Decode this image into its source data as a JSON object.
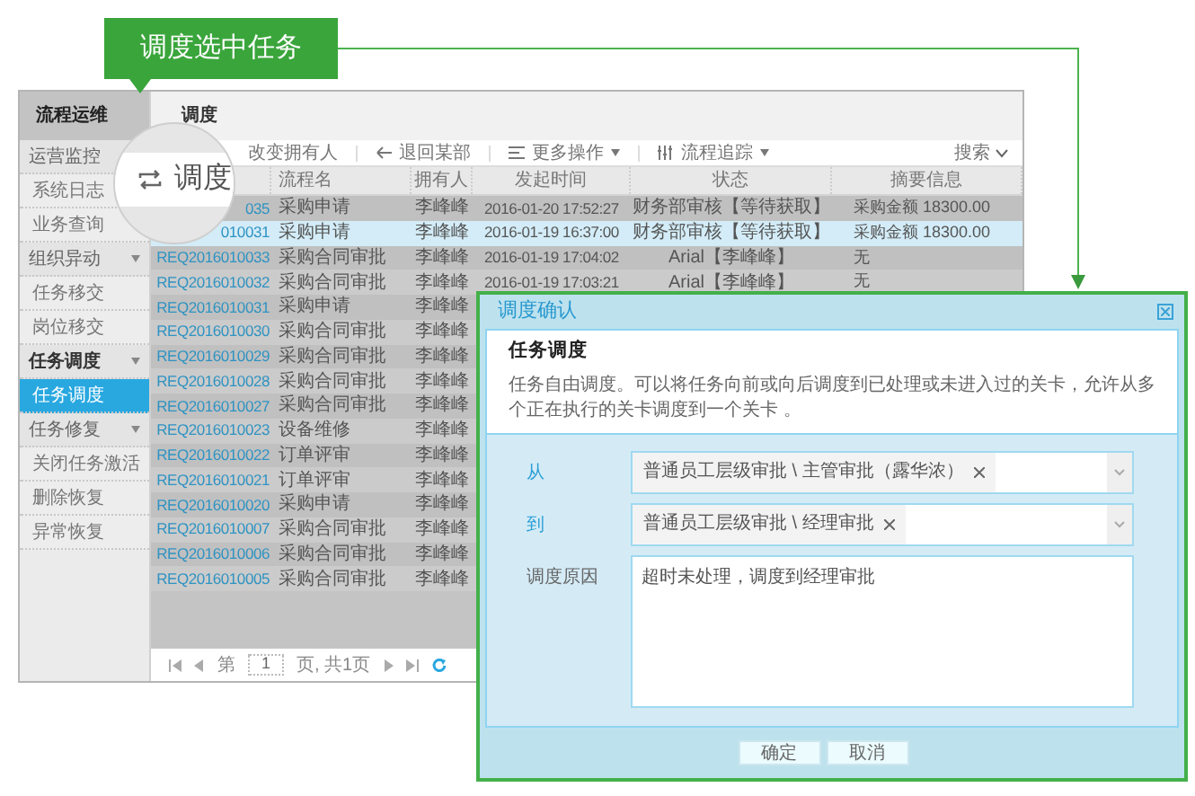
{
  "callout": {
    "text": "调度选中任务"
  },
  "sidebar": {
    "title": "流程运维",
    "groups": [
      {
        "label": "运营监控",
        "collapsible": false,
        "children": [
          {
            "label": "系统日志",
            "selected": false
          },
          {
            "label": "业务查询",
            "selected": false
          }
        ]
      },
      {
        "label": "组织异动",
        "collapsible": true,
        "children": [
          {
            "label": "任务移交",
            "selected": false
          },
          {
            "label": "岗位移交",
            "selected": false
          }
        ]
      },
      {
        "label": "任务调度",
        "collapsible": true,
        "children": [
          {
            "label": "任务调度",
            "selected": true
          }
        ]
      },
      {
        "label": "任务修复",
        "collapsible": true,
        "children": [
          {
            "label": "关闭任务激活",
            "selected": false
          },
          {
            "label": "删除恢复",
            "selected": false
          },
          {
            "label": "异常恢复",
            "selected": false
          }
        ]
      }
    ]
  },
  "header": {
    "title": "调度"
  },
  "magnifier": {
    "label": "调度"
  },
  "toolbar": {
    "items": [
      {
        "label": "改变拥有人",
        "dropdown": false
      },
      {
        "label": "退回某部",
        "dropdown": false
      },
      {
        "label": "更多操作",
        "dropdown": true
      },
      {
        "label": "流程追踪",
        "dropdown": true
      }
    ],
    "search": "搜索"
  },
  "table": {
    "columns": [
      "流程名",
      "拥有人",
      "发起时间",
      "状态",
      "摘要信息"
    ],
    "rows": [
      {
        "id": "035",
        "name": "采购申请",
        "owner": "李峰峰",
        "time": "2016-01-20 17:52:27",
        "status": "财务部审核【等待获取】",
        "summary": "采购金额 18300.00",
        "selected": false
      },
      {
        "id": "010031",
        "name": "采购申请",
        "owner": "李峰峰",
        "time": "2016-01-19 16:37:00",
        "status": "财务部审核【等待获取】",
        "summary": "采购金额 18300.00",
        "selected": true
      },
      {
        "id": "REQ2016010033",
        "name": "采购合同审批",
        "owner": "李峰峰",
        "time": "2016-01-19 17:04:02",
        "status": "Arial【李峰峰】",
        "summary": "无",
        "selected": false
      },
      {
        "id": "REQ2016010032",
        "name": "采购合同审批",
        "owner": "李峰峰",
        "time": "2016-01-19 17:03:21",
        "status": "Arial【李峰峰】",
        "summary": "无",
        "selected": false
      },
      {
        "id": "REQ2016010031",
        "name": "采购申请",
        "owner": "李峰峰",
        "selected": false
      },
      {
        "id": "REQ2016010030",
        "name": "采购合同审批",
        "owner": "李峰峰",
        "selected": false
      },
      {
        "id": "REQ2016010029",
        "name": "采购合同审批",
        "owner": "李峰峰",
        "selected": false
      },
      {
        "id": "REQ2016010028",
        "name": "采购合同审批",
        "owner": "李峰峰",
        "selected": false
      },
      {
        "id": "REQ2016010027",
        "name": "采购合同审批",
        "owner": "李峰峰",
        "selected": false
      },
      {
        "id": "REQ2016010023",
        "name": "设备维修",
        "owner": "李峰峰",
        "selected": false
      },
      {
        "id": "REQ2016010022",
        "name": "订单评审",
        "owner": "李峰峰",
        "selected": false
      },
      {
        "id": "REQ2016010021",
        "name": "订单评审",
        "owner": "李峰峰",
        "selected": false
      },
      {
        "id": "REQ2016010020",
        "name": "采购申请",
        "owner": "李峰峰",
        "selected": false
      },
      {
        "id": "REQ2016010007",
        "name": "采购合同审批",
        "owner": "李峰峰",
        "selected": false
      },
      {
        "id": "REQ2016010006",
        "name": "采购合同审批",
        "owner": "李峰峰",
        "selected": false
      },
      {
        "id": "REQ2016010005",
        "name": "采购合同审批",
        "owner": "李峰峰",
        "selected": false
      }
    ]
  },
  "pagination": {
    "before": "第",
    "page": "1",
    "after": "页, 共1页"
  },
  "dialog": {
    "title": "调度确认",
    "section_title": "任务调度",
    "description": "任务自由调度。可以将任务向前或向后调度到已处理或未进入过的关卡，允许从多个正在执行的关卡调度到一个关卡 。",
    "fields": [
      {
        "label": "从",
        "kind": "select",
        "tag": "普通员工层级审批 \\ 主管审批（露华浓）"
      },
      {
        "label": "到",
        "kind": "select",
        "tag": "普通员工层级审批 \\ 经理审批"
      },
      {
        "label": "调度原因",
        "kind": "textarea",
        "value": "超时未处理，调度到经理审批"
      }
    ],
    "buttons": [
      "确定",
      "取消"
    ]
  }
}
